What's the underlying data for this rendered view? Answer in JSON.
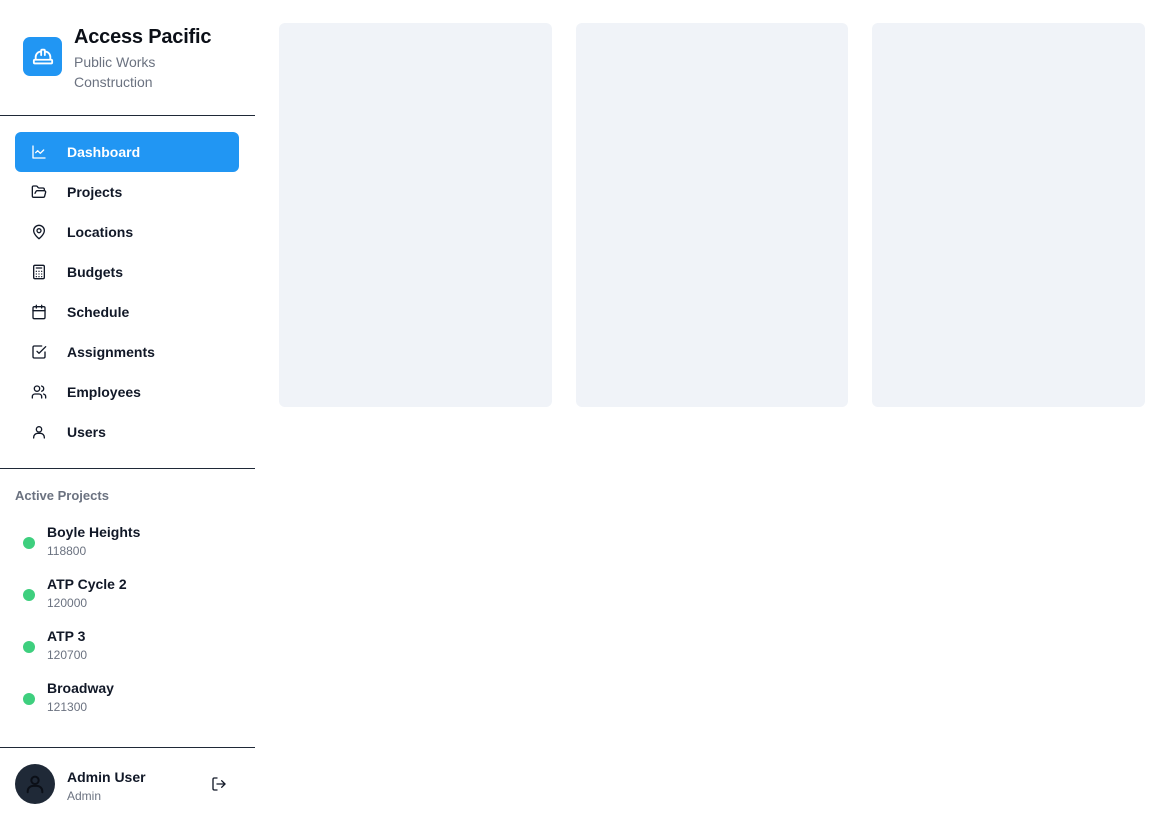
{
  "brand": {
    "title": "Access Pacific",
    "subtitle": "Public Works Construction",
    "icon": "hard-hat-icon",
    "accent": "#2196f3"
  },
  "nav": {
    "items": [
      {
        "label": "Dashboard",
        "icon": "chart-line-icon",
        "active": true
      },
      {
        "label": "Projects",
        "icon": "folder-open-icon",
        "active": false
      },
      {
        "label": "Locations",
        "icon": "map-pin-icon",
        "active": false
      },
      {
        "label": "Budgets",
        "icon": "calculator-icon",
        "active": false
      },
      {
        "label": "Schedule",
        "icon": "calendar-icon",
        "active": false
      },
      {
        "label": "Assignments",
        "icon": "check-square-icon",
        "active": false
      },
      {
        "label": "Employees",
        "icon": "users-icon",
        "active": false
      },
      {
        "label": "Users",
        "icon": "user-icon",
        "active": false
      }
    ]
  },
  "active_projects": {
    "title": "Active Projects",
    "status_color": "#3ecf7e",
    "items": [
      {
        "name": "Boyle Heights",
        "code": "118800"
      },
      {
        "name": "ATP Cycle 2",
        "code": "120000"
      },
      {
        "name": "ATP 3",
        "code": "120700"
      },
      {
        "name": "Broadway",
        "code": "121300"
      }
    ]
  },
  "user": {
    "name": "Admin User",
    "role": "Admin",
    "avatar_icon": "user-icon",
    "logout_icon": "log-out-icon"
  },
  "main": {
    "loading_cards": 3,
    "card_color": "#f0f3f8"
  }
}
